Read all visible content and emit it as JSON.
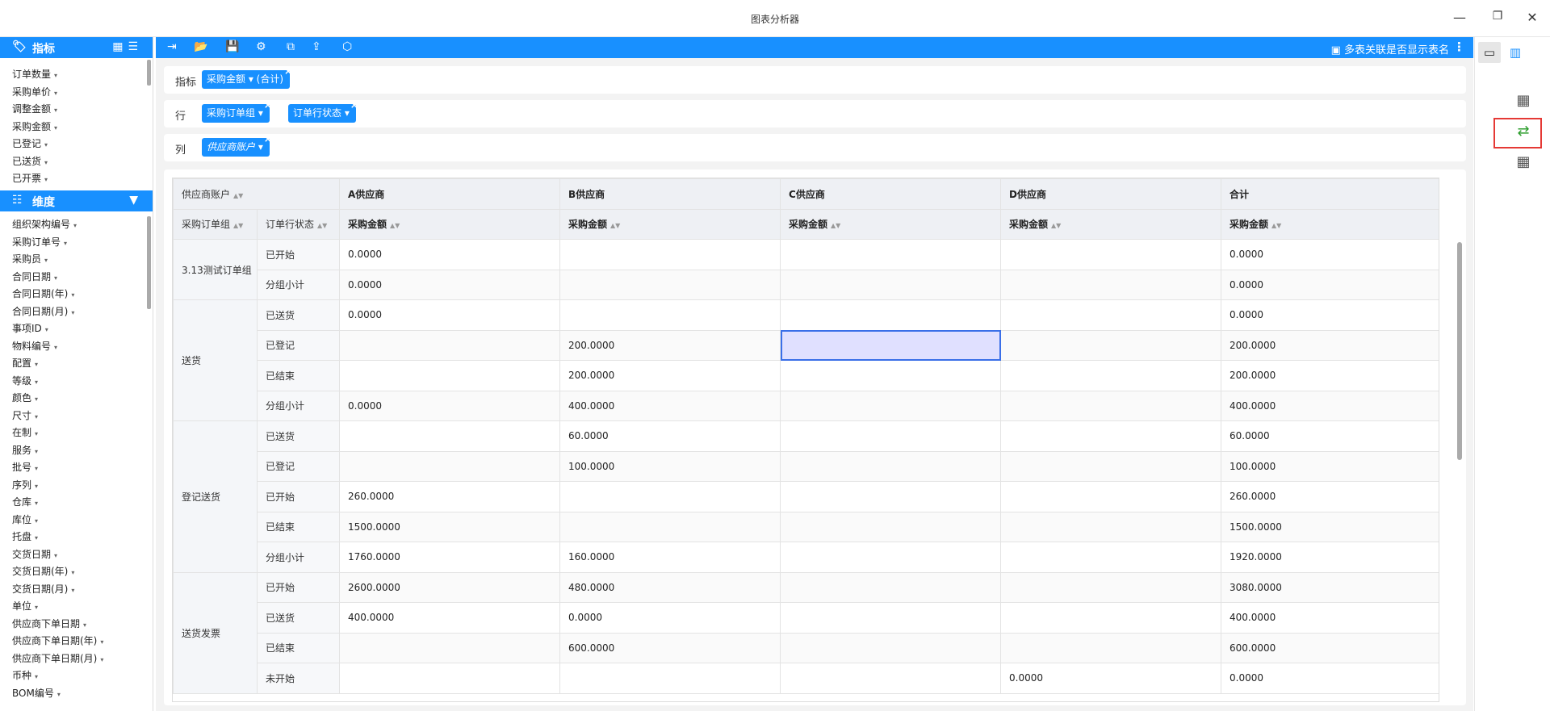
{
  "window": {
    "title": "图表分析器",
    "minimize_icon": "—",
    "restore_icon": "❐",
    "close_icon": "✕"
  },
  "left_panel": {
    "metrics_title": "指标",
    "metrics": [
      "订单数量",
      "采购单价",
      "调整金额",
      "采购金额",
      "已登记",
      "已送货",
      "已开票"
    ],
    "dimensions_title": "维度",
    "dimensions": [
      "组织架构编号",
      "采购订单号",
      "采购员",
      "合同日期",
      "合同日期(年)",
      "合同日期(月)",
      "事项ID",
      "物料编号",
      "配置",
      "等级",
      "颜色",
      "尺寸",
      "在制",
      "服务",
      "批号",
      "序列",
      "仓库",
      "库位",
      "托盘",
      "交货日期",
      "交货日期(年)",
      "交货日期(月)",
      "单位",
      "供应商下单日期",
      "供应商下单日期(年)",
      "供应商下单日期(月)",
      "币种",
      "BOM编号"
    ]
  },
  "toolbar": {
    "right_label": "多表关联是否显示表名"
  },
  "fields": {
    "metric_label": "指标",
    "metric_chip": "采购金额 ▾ (合计)",
    "row_label": "行",
    "row_chips": [
      "采购订单组 ▾",
      "订单行状态 ▾"
    ],
    "col_label": "列",
    "col_chip": "供应商账户 ▾"
  },
  "table": {
    "corner_label": "供应商账户",
    "suppliers": [
      "A供应商",
      "B供应商",
      "C供应商",
      "D供应商",
      "合计"
    ],
    "row_header1": "采购订单组",
    "row_header2": "订单行状态",
    "measure": "采购金额",
    "groups": [
      {
        "name": "3.13测试订单组",
        "rows": [
          {
            "status": "已开始",
            "values": [
              "0.0000",
              "",
              "",
              "",
              "0.0000"
            ]
          },
          {
            "status": "分组小计",
            "values": [
              "0.0000",
              "",
              "",
              "",
              "0.0000"
            ]
          }
        ]
      },
      {
        "name": "送货",
        "rows": [
          {
            "status": "已送货",
            "values": [
              "0.0000",
              "",
              "",
              "",
              "0.0000"
            ]
          },
          {
            "status": "已登记",
            "values": [
              "",
              "200.0000",
              "",
              "",
              "200.0000"
            ]
          },
          {
            "status": "已结束",
            "values": [
              "",
              "200.0000",
              "",
              "",
              "200.0000"
            ]
          },
          {
            "status": "分组小计",
            "values": [
              "0.0000",
              "400.0000",
              "",
              "",
              "400.0000"
            ]
          }
        ]
      },
      {
        "name": "登记送货",
        "rows": [
          {
            "status": "已送货",
            "values": [
              "",
              "60.0000",
              "",
              "",
              "60.0000"
            ]
          },
          {
            "status": "已登记",
            "values": [
              "",
              "100.0000",
              "",
              "",
              "100.0000"
            ]
          },
          {
            "status": "已开始",
            "values": [
              "260.0000",
              "",
              "",
              "",
              "260.0000"
            ]
          },
          {
            "status": "已结束",
            "values": [
              "1500.0000",
              "",
              "",
              "",
              "1500.0000"
            ]
          },
          {
            "status": "分组小计",
            "values": [
              "1760.0000",
              "160.0000",
              "",
              "",
              "1920.0000"
            ]
          }
        ]
      },
      {
        "name": "送货发票",
        "rows": [
          {
            "status": "已开始",
            "values": [
              "2600.0000",
              "480.0000",
              "",
              "",
              "3080.0000"
            ]
          },
          {
            "status": "已送货",
            "values": [
              "400.0000",
              "0.0000",
              "",
              "",
              "400.0000"
            ]
          },
          {
            "status": "已结束",
            "values": [
              "",
              "600.0000",
              "",
              "",
              "600.0000"
            ]
          },
          {
            "status": "未开始",
            "values": [
              "",
              "",
              "",
              "0.0000",
              "0.0000"
            ]
          }
        ]
      }
    ]
  },
  "icons": {
    "tag": "tag-icon",
    "grid": "grid-icon",
    "menu": "menu-icon",
    "filter": "filter-icon",
    "sliders": "sliders-icon"
  }
}
